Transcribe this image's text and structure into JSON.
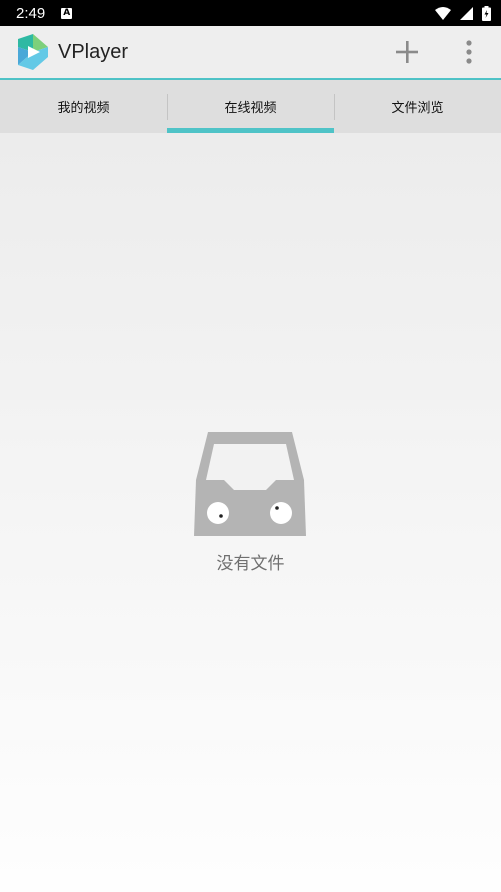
{
  "status_bar": {
    "time": "2:49",
    "notification_icon_letter": "A",
    "icons": [
      "wifi-icon",
      "signal-icon",
      "battery-icon"
    ]
  },
  "app_bar": {
    "title": "VPlayer",
    "actions": [
      "add-icon",
      "more-vert-icon"
    ]
  },
  "tabs": [
    {
      "label": "我的视频",
      "active": false
    },
    {
      "label": "在线视频",
      "active": true
    },
    {
      "label": "文件浏览",
      "active": false
    }
  ],
  "empty_state": {
    "message": "没有文件",
    "icon": "empty-box-icon"
  },
  "colors": {
    "accent": "#4fc3c7",
    "status_bar": "#000000",
    "app_bar": "#eeeeee",
    "tab_bar": "#dedede",
    "empty_icon": "#b4b4b4"
  }
}
